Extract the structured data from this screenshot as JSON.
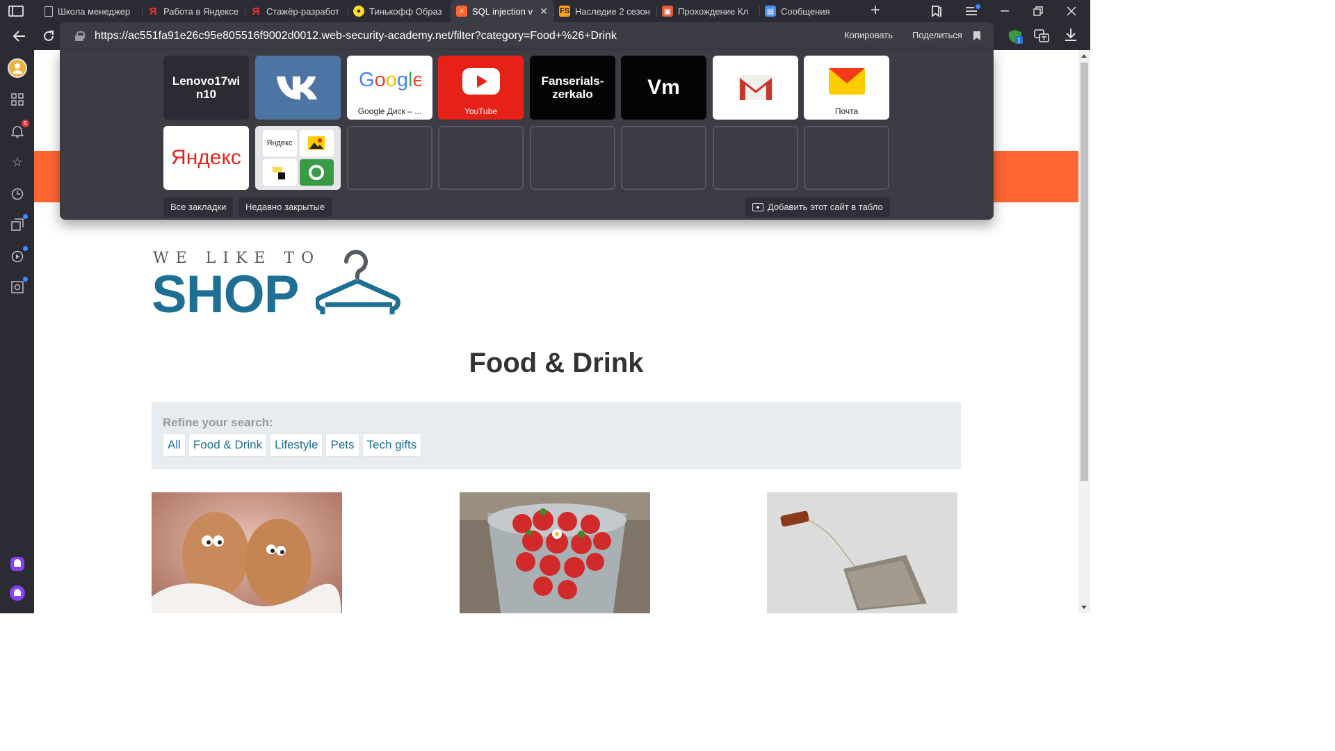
{
  "tabs": [
    {
      "label": "Школа менеджер",
      "favicon": "document-icon",
      "active": false
    },
    {
      "label": "Работа в Яндексе",
      "favicon": "yandex-icon",
      "active": false
    },
    {
      "label": "Стажёр-разработ",
      "favicon": "yandex-icon",
      "active": false
    },
    {
      "label": "Тинькофф Образ",
      "favicon": "tinkoff-icon",
      "active": false
    },
    {
      "label": "SQL injection v",
      "favicon": "portswigger-icon",
      "active": true
    },
    {
      "label": "Наследие 2 сезон",
      "favicon": "fs-icon",
      "active": false
    },
    {
      "label": "Прохождение Кл",
      "favicon": "game-icon",
      "active": false
    },
    {
      "label": "Сообщения",
      "favicon": "messages-icon",
      "active": false
    }
  ],
  "toolbar": {
    "url": "https://ac551fa91e26c95e805516f9002d0012.web-security-academy.net/filter?category=Food+%26+Drink",
    "copy_label": "Копировать",
    "share_label": "Поделиться"
  },
  "sidebar": {
    "notification_badge": "5"
  },
  "speed_dial": {
    "tiles": [
      {
        "title": "Lenovo17wi n10",
        "caption": ""
      },
      {
        "title": "VK",
        "caption": ""
      },
      {
        "title": "Google",
        "caption": "Google Диск – ..."
      },
      {
        "title": "YouTube",
        "caption": "YouTube"
      },
      {
        "title": "Fanserials- zerkalo",
        "caption": ""
      },
      {
        "title": "Vm",
        "caption": ""
      },
      {
        "title": "Gmail",
        "caption": ""
      },
      {
        "title": "Почта",
        "caption": "Почта"
      },
      {
        "title": "Яндекс",
        "caption": ""
      },
      {
        "title": "Яндекс",
        "caption": ""
      }
    ],
    "all_bookmarks_label": "Все закладки",
    "recently_closed_label": "Недавно закрытые",
    "add_site_label": "Добавить этот сайт в табло"
  },
  "page": {
    "logo_top": "WE LIKE TO",
    "logo_main": "SHOP",
    "title": "Food & Drink",
    "refine_label": "Refine your search:",
    "filters": [
      "All",
      "Food & Drink",
      "Lifestyle",
      "Pets",
      "Tech gifts"
    ],
    "brand_color": "#ff6633",
    "accent_color": "#1d6f94"
  }
}
